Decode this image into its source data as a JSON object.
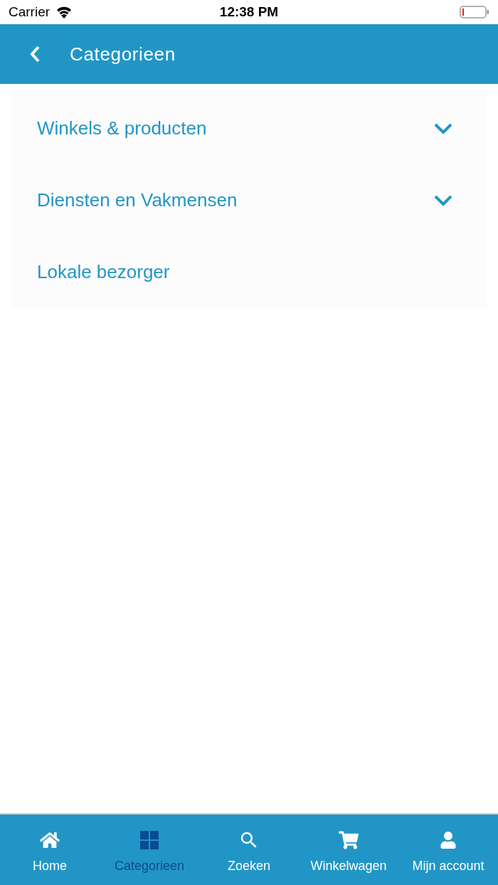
{
  "status_bar": {
    "carrier": "Carrier",
    "time": "12:38 PM"
  },
  "header": {
    "title": "Categorieen"
  },
  "categories": [
    {
      "label": "Winkels & producten",
      "kind": "expandable",
      "expanded": false
    },
    {
      "label": "Diensten en Vakmensen",
      "kind": "expandable",
      "expanded": false
    },
    {
      "label": "Lokale bezorger",
      "kind": "link"
    }
  ],
  "tab_bar": [
    {
      "label": "Home",
      "kind": "home",
      "selected": false
    },
    {
      "label": "Categorieen",
      "kind": "grid",
      "selected": true
    },
    {
      "label": "Zoeken",
      "kind": "search",
      "selected": false
    },
    {
      "label": "Winkelwagen",
      "kind": "cart",
      "selected": false
    },
    {
      "label": "Mijn account",
      "kind": "person",
      "selected": false
    }
  ]
}
